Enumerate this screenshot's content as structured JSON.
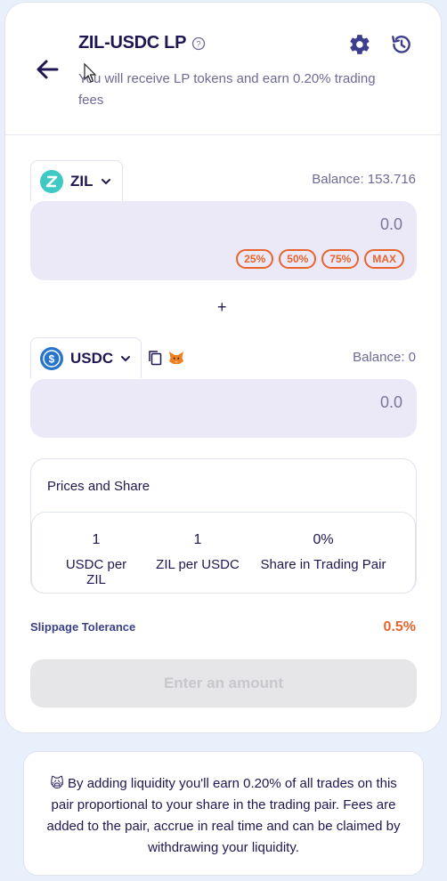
{
  "header": {
    "title": "ZIL-USDC LP",
    "subtitle": "You will receive LP tokens and earn 0.20% trading fees"
  },
  "token_a": {
    "symbol": "ZIL",
    "balance": "Balance: 153.716",
    "amount": "0.0",
    "percent_buttons": [
      "25%",
      "50%",
      "75%",
      "MAX"
    ]
  },
  "plus_sign": "+",
  "token_b": {
    "symbol": "USDC",
    "balance": "Balance: 0",
    "amount": "0.0"
  },
  "prices": {
    "title": "Prices and Share",
    "stats": [
      {
        "value": "1",
        "label": "USDC per ZIL"
      },
      {
        "value": "1",
        "label": "ZIL per USDC"
      },
      {
        "value": "0%",
        "label": "Share in Trading Pair"
      }
    ]
  },
  "slippage": {
    "label": "Slippage Tolerance",
    "value": "0.5%"
  },
  "submit_label": "Enter an amount",
  "info": {
    "emoji": "🙀",
    "text": "By adding liquidity you'll earn 0.20% of all trades on this pair proportional to your share in the trading pair. Fees are added to the pair, accrue in real time and can be claimed by withdrawing your liquidity."
  },
  "colors": {
    "accent": "#e8642c",
    "text_primary": "#1f1752",
    "amount_bg": "#ebe9f7",
    "zil_token": "#3ec9c4",
    "usdc_token": "#2775ca"
  }
}
